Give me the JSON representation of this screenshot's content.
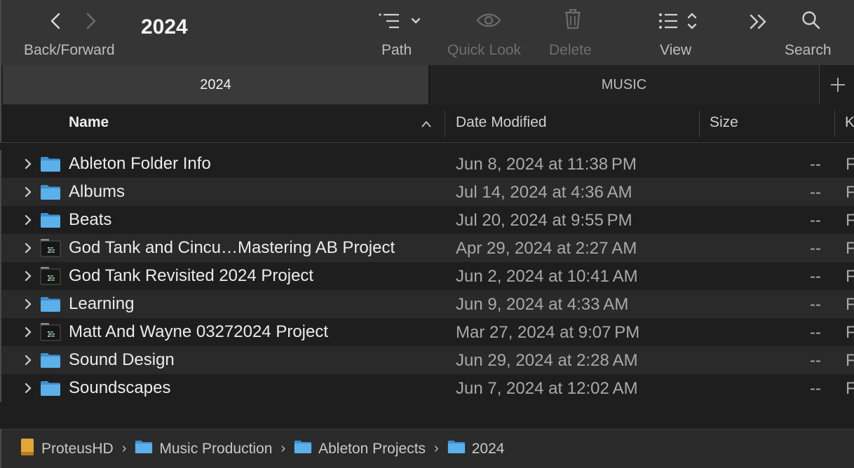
{
  "window": {
    "title": "2024"
  },
  "toolbar": {
    "back_forward_label": "Back/Forward",
    "path_label": "Path",
    "quicklook_label": "Quick Look",
    "delete_label": "Delete",
    "view_label": "View",
    "search_label": "Search"
  },
  "tabs": [
    {
      "label": "2024",
      "active": true
    },
    {
      "label": "MUSIC",
      "active": false
    }
  ],
  "columns": {
    "name": "Name",
    "date": "Date Modified",
    "size": "Size",
    "kind": "K"
  },
  "rows": [
    {
      "name": "Ableton Folder Info",
      "date": "Jun 8, 2024 at 11:38 PM",
      "size": "--",
      "kind": "F",
      "icon": "folder-icon"
    },
    {
      "name": "Albums",
      "date": "Jul 14, 2024 at 4:36 AM",
      "size": "--",
      "kind": "F",
      "icon": "folder-icon"
    },
    {
      "name": "Beats",
      "date": "Jul 20, 2024 at 9:55 PM",
      "size": "--",
      "kind": "F",
      "icon": "folder-icon"
    },
    {
      "name": "God Tank and Cincu…Mastering AB Project",
      "date": "Apr 29, 2024 at 2:27 AM",
      "size": "--",
      "kind": "F",
      "icon": "ableton-project-icon"
    },
    {
      "name": "God Tank Revisited 2024 Project",
      "date": "Jun 2, 2024 at 10:41 AM",
      "size": "--",
      "kind": "F",
      "icon": "ableton-project-icon"
    },
    {
      "name": "Learning",
      "date": "Jun 9, 2024 at 4:33 AM",
      "size": "--",
      "kind": "F",
      "icon": "folder-icon"
    },
    {
      "name": "Matt And Wayne 03272024 Project",
      "date": "Mar 27, 2024 at 9:07 PM",
      "size": "--",
      "kind": "F",
      "icon": "ableton-project-icon"
    },
    {
      "name": "Sound Design",
      "date": "Jun 29, 2024 at 2:28 AM",
      "size": "--",
      "kind": "F",
      "icon": "folder-icon"
    },
    {
      "name": "Soundscapes",
      "date": "Jun 7, 2024 at 12:02 AM",
      "size": "--",
      "kind": "F",
      "icon": "folder-icon"
    }
  ],
  "pathbar": [
    {
      "label": "ProteusHD",
      "icon": "drive-icon"
    },
    {
      "label": "Music Production",
      "icon": "folder-icon"
    },
    {
      "label": "Ableton Projects",
      "icon": "folder-icon"
    },
    {
      "label": "2024",
      "icon": "folder-icon"
    }
  ],
  "colors": {
    "folder": "#5cb0ea",
    "background": "#1e1e1e",
    "toolbar": "#353535"
  }
}
